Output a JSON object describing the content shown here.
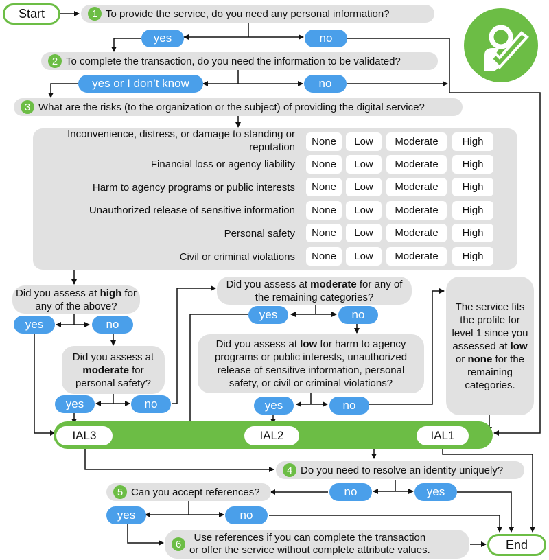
{
  "start_label": "Start",
  "end_label": "End",
  "badge_icon": "person-check-icon",
  "q1": {
    "num": "1",
    "text": "To provide the service, do you need any personal information?",
    "yes": "yes",
    "no": "no"
  },
  "q2": {
    "num": "2",
    "text": "To complete the transaction, do you need the information to be validated?",
    "yes": "yes or I don’t know",
    "no": "no"
  },
  "q3": {
    "num": "3",
    "text": "What are the risks (to the organization or the subject) of providing the digital service?"
  },
  "risk_levels": [
    "None",
    "Low",
    "Moderate",
    "High"
  ],
  "risk_categories": [
    "Inconvenience, distress, or damage to standing or reputation",
    "Financial loss or agency liability",
    "Harm to agency programs or public interests",
    "Unauthorized release of sensitive information",
    "Personal safety",
    "Civil or criminal violations"
  ],
  "high_q": {
    "pre": "Did you assess at ",
    "bold": "high",
    "post": " for any of the above?",
    "yes": "yes",
    "no": "no"
  },
  "mod_safety_q": {
    "pre": "Did you assess at ",
    "bold": "moderate",
    "post": " for personal safety?",
    "yes": "yes",
    "no": "no"
  },
  "mod_any_q": {
    "pre": "Did you assess at ",
    "bold": "moderate",
    "post": " for any of the remaining categories?",
    "yes": "yes",
    "no": "no"
  },
  "low_q": {
    "pre": "Did you assess at ",
    "bold": "low",
    "post": " for harm to agency programs or public interests, unauthorized release of sensitive information, personal safety, or civil or criminal violations?",
    "yes": "yes",
    "no": "no"
  },
  "level1_note": {
    "pre": "The service fits the profile for level 1 since you assessed at ",
    "b1": "low",
    "mid": " or ",
    "b2": "none",
    "post": " for the remaining categories."
  },
  "ial": [
    "IAL3",
    "IAL2",
    "IAL1"
  ],
  "q4": {
    "num": "4",
    "text": "Do you need to resolve an identity uniquely?",
    "no": "no",
    "yes": "yes"
  },
  "q5": {
    "num": "5",
    "text": "Can you accept references?",
    "yes": "yes",
    "no": "no"
  },
  "q6": {
    "num": "6",
    "line1": "Use references if you can complete the transaction",
    "line2": "or offer the service without complete attribute values."
  },
  "colors": {
    "green": "#6cbd45",
    "blue": "#4a9fea",
    "gray": "#e1e1e1"
  }
}
